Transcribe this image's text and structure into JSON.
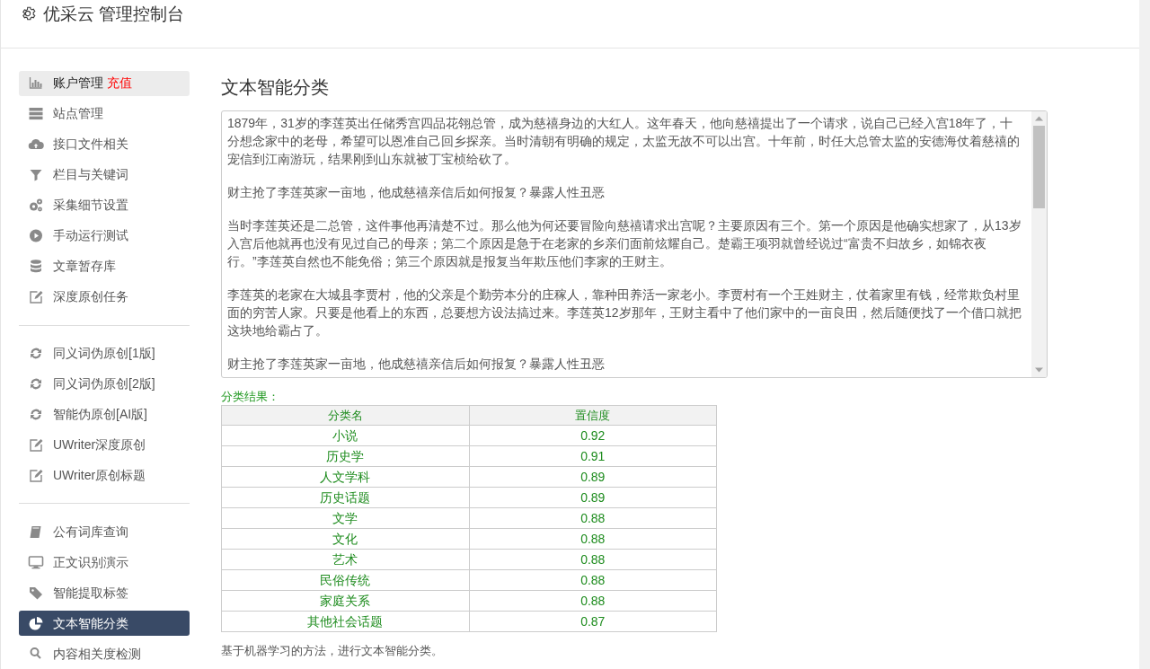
{
  "header": {
    "title": "优采云 管理控制台"
  },
  "sidebar": {
    "groups": [
      [
        {
          "label": "账户管理",
          "badge": "充值",
          "highlighted": true,
          "selected": false
        },
        {
          "label": "站点管理",
          "highlighted": false,
          "selected": false
        },
        {
          "label": "接口文件相关",
          "highlighted": false,
          "selected": false
        },
        {
          "label": "栏目与关键词",
          "highlighted": false,
          "selected": false
        },
        {
          "label": "采集细节设置",
          "highlighted": false,
          "selected": false
        },
        {
          "label": "手动运行测试",
          "highlighted": false,
          "selected": false
        },
        {
          "label": "文章暂存库",
          "highlighted": false,
          "selected": false
        },
        {
          "label": "深度原创任务",
          "highlighted": false,
          "selected": false
        }
      ],
      [
        {
          "label": "同义词伪原创[1版]",
          "highlighted": false,
          "selected": false
        },
        {
          "label": "同义词伪原创[2版]",
          "highlighted": false,
          "selected": false
        },
        {
          "label": "智能伪原创[AI版]",
          "highlighted": false,
          "selected": false
        },
        {
          "label": "UWriter深度原创",
          "highlighted": false,
          "selected": false
        },
        {
          "label": "UWriter原创标题",
          "highlighted": false,
          "selected": false
        }
      ],
      [
        {
          "label": "公有词库查询",
          "highlighted": false,
          "selected": false
        },
        {
          "label": "正文识别演示",
          "highlighted": false,
          "selected": false
        },
        {
          "label": "智能提取标签",
          "highlighted": false,
          "selected": false
        },
        {
          "label": "文本智能分类",
          "highlighted": false,
          "selected": true
        },
        {
          "label": "内容相关度检测",
          "highlighted": false,
          "selected": false
        }
      ]
    ]
  },
  "main": {
    "title": "文本智能分类",
    "text_area": {
      "paragraphs": [
        "1879年，31岁的李莲英出任储秀宫四品花翎总管，成为慈禧身边的大红人。这年春天，他向慈禧提出了一个请求，说自己已经入宫18年了，十分想念家中的老母，希望可以恩准自己回乡探亲。当时清朝有明确的规定，太监无故不可以出宫。十年前，时任大总管太监的安德海仗着慈禧的宠信到江南游玩，结果刚到山东就被丁宝桢给砍了。",
        "财主抢了李莲英家一亩地，他成慈禧亲信后如何报复？暴露人性丑恶",
        "当时李莲英还是二总管，这件事他再清楚不过。那么他为何还要冒险向慈禧请求出宫呢？主要原因有三个。第一个原因是他确实想家了，从13岁入宫后他就再也没有见过自己的母亲；第二个原因是急于在老家的乡亲们面前炫耀自己。楚霸王项羽就曾经说过“富贵不归故乡，如锦衣夜行。”李莲英自然也不能免俗；第三个原因就是报复当年欺压他们李家的王财主。",
        "李莲英的老家在大城县李贾村，他的父亲是个勤劳本分的庄稼人，靠种田养活一家老小。李贾村有一个王姓财主，仗着家里有钱，经常欺负村里面的穷苦人家。只要是他看上的东西，总要想方设法搞过来。李莲英12岁那年，王财主看中了他们家中的一亩良田，然后随便找了一个借口就把这块地给霸占了。",
        "财主抢了李莲英家一亩地，他成慈禧亲信后如何报复？暴露人性丑恶"
      ]
    },
    "result_label": "分类结果：",
    "table": {
      "columns": [
        "分类名",
        "置信度"
      ],
      "rows": [
        [
          "小说",
          "0.92"
        ],
        [
          "历史学",
          "0.91"
        ],
        [
          "人文学科",
          "0.89"
        ],
        [
          "历史话题",
          "0.89"
        ],
        [
          "文学",
          "0.88"
        ],
        [
          "文化",
          "0.88"
        ],
        [
          "艺术",
          "0.88"
        ],
        [
          "民俗传统",
          "0.88"
        ],
        [
          "家庭关系",
          "0.88"
        ],
        [
          "其他社会话题",
          "0.87"
        ]
      ]
    },
    "note": "基于机器学习的方法，进行文本智能分类。"
  }
}
